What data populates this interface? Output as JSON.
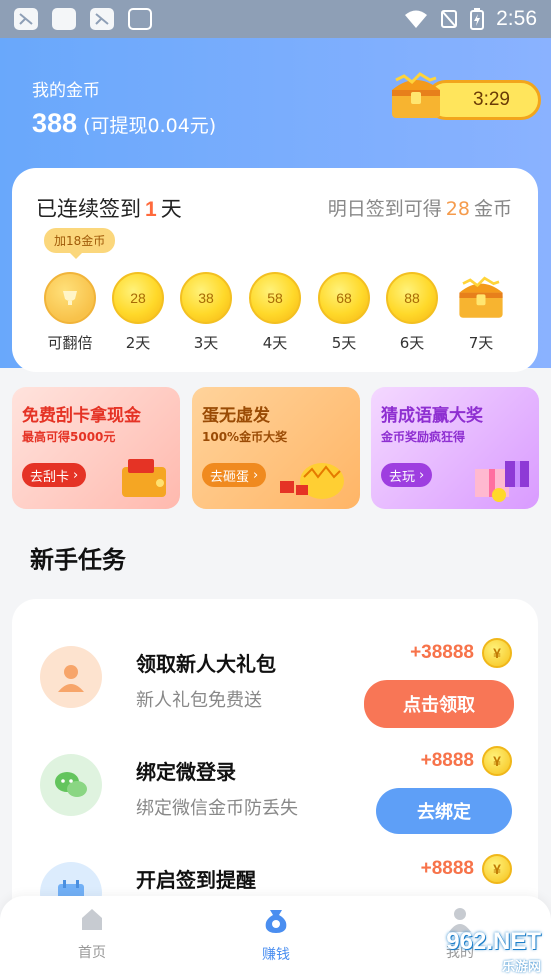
{
  "status_bar": {
    "time": "2:56"
  },
  "header": {
    "coin_label": "我的金币",
    "coin_amount": "388",
    "withdraw_text": "(可提现0.04元)",
    "timer": "3:29"
  },
  "signin": {
    "prefix": "已连续签到",
    "days": "1",
    "suffix": "天",
    "tomorrow_prefix": "明日签到可得",
    "tomorrow_amount": "28",
    "tomorrow_suffix": "金币",
    "bubble": "加18金币",
    "items": [
      {
        "value": "",
        "label": "可翻倍"
      },
      {
        "value": "28",
        "label": "2天"
      },
      {
        "value": "38",
        "label": "3天"
      },
      {
        "value": "58",
        "label": "4天"
      },
      {
        "value": "68",
        "label": "5天"
      },
      {
        "value": "88",
        "label": "6天"
      },
      {
        "value": "",
        "label": "7天"
      }
    ]
  },
  "promos": [
    {
      "title": "免费刮卡拿现金",
      "subtitle": "最高可得5000元",
      "button": "去刮卡"
    },
    {
      "title": "蛋无虚发",
      "subtitle": "100%金币大奖",
      "button": "去砸蛋"
    },
    {
      "title": "猜成语赢大奖",
      "subtitle": "金币奖励疯狂得",
      "button": "去玩"
    }
  ],
  "section_title": "新手任务",
  "tasks": [
    {
      "title": "领取新人大礼包",
      "desc": "新人礼包免费送",
      "reward": "+38888",
      "button": "点击领取"
    },
    {
      "title": "绑定微登录",
      "desc": "绑定微信金币防丢失",
      "reward": "+8888",
      "button": "去绑定"
    },
    {
      "title": "开启签到提醒",
      "desc": "",
      "reward": "+8888",
      "button": ""
    }
  ],
  "nav": [
    {
      "label": "首页"
    },
    {
      "label": "赚钱"
    },
    {
      "label": "我的"
    }
  ],
  "watermark": {
    "main": "962.NET",
    "sub": "乐游网"
  },
  "colors": {
    "accent_blue": "#5e9ff7",
    "accent_orange": "#f87656",
    "header_blue": "#69a8fb"
  }
}
